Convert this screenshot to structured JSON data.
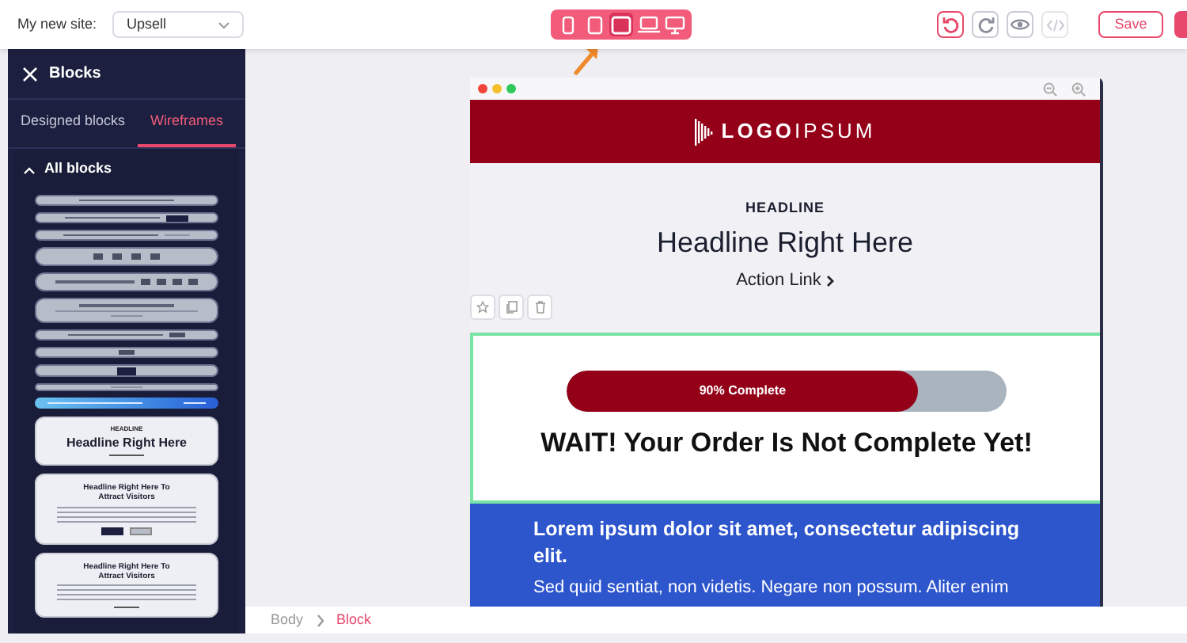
{
  "topbar": {
    "site_label": "My new site:",
    "site_select": {
      "value": "Upsell"
    },
    "devices": [
      {
        "kind": "phone",
        "selected": false
      },
      {
        "kind": "phablet",
        "selected": false
      },
      {
        "kind": "tablet",
        "selected": true
      },
      {
        "kind": "laptop",
        "selected": false
      },
      {
        "kind": "desktop",
        "selected": false
      }
    ],
    "actions": [
      {
        "kind": "undo",
        "disabled": false
      },
      {
        "kind": "redo",
        "disabled": false
      },
      {
        "kind": "preview",
        "disabled": false
      },
      {
        "kind": "code",
        "disabled": true
      }
    ],
    "save": "Save"
  },
  "sidebar": {
    "title": "Blocks",
    "tabs": [
      {
        "label": "Designed blocks",
        "selected": false
      },
      {
        "label": "Wireframes",
        "selected": true
      }
    ],
    "section": {
      "label": "All blocks",
      "expanded": true
    },
    "thumbnails": [
      {
        "kind": "bar"
      },
      {
        "kind": "bar-button"
      },
      {
        "kind": "bar-text"
      },
      {
        "kind": "countdown"
      },
      {
        "kind": "text-countdown"
      },
      {
        "kind": "text-block"
      },
      {
        "kind": "bar-icons"
      },
      {
        "kind": "icons"
      },
      {
        "kind": "button"
      },
      {
        "kind": "thin"
      },
      {
        "kind": "gradient"
      }
    ],
    "cards": [
      {
        "kind": "headline",
        "eyebrow": "HEADLINE",
        "title": "Headline Right Here"
      },
      {
        "kind": "two-buttons",
        "title": "Headline Right Here To Attract Visitors"
      },
      {
        "kind": "link",
        "title": "Headline Right Here To Attract Visitors"
      }
    ]
  },
  "preview": {
    "logo": "**LOGO**IPSUM",
    "eyebrow": "HEADLINE",
    "headline": "Headline Right Here",
    "action_link": "Action Link",
    "progress": {
      "label": "90% Complete",
      "level": 0.8
    },
    "warning": "WAIT! Your Order Is Not Complete Yet!",
    "lead": "Lorem ipsum dolor sit amet, consectetur adipiscing elit.",
    "body": "Sed quid sentiat, non videtis. Negare non possum. Aliter enim"
  },
  "breadcrumb": [
    {
      "label": "Body",
      "selected": false
    },
    {
      "label": "Block",
      "selected": true
    }
  ]
}
